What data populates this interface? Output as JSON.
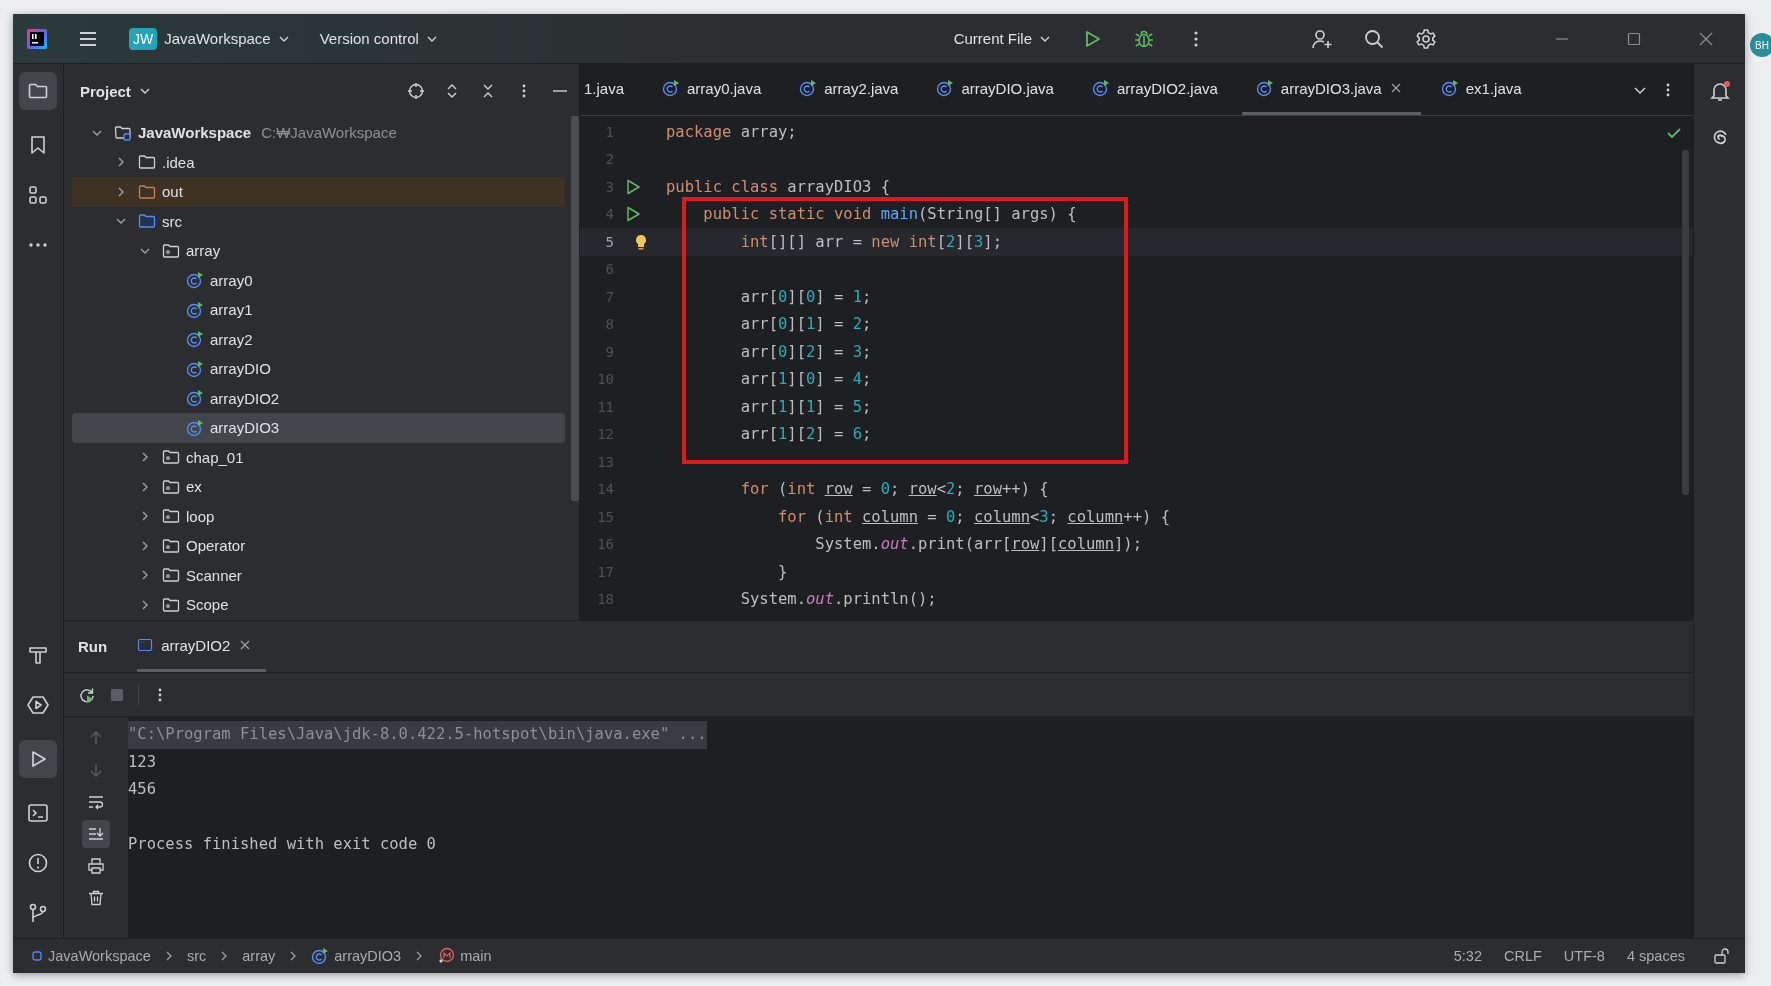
{
  "desktop": {
    "avatar": "BH"
  },
  "titlebar": {
    "project_badge": "JW",
    "project": "JavaWorkspace",
    "vcs": "Version control",
    "run_config": "Current File"
  },
  "project": {
    "title": "Project",
    "tree": [
      {
        "kind": "root",
        "label": "JavaWorkspace",
        "path": "C:₩JavaWorkspace",
        "expanded": true,
        "selected": false,
        "children": [
          {
            "kind": "folder",
            "label": ".idea",
            "expanded": false,
            "selected": false
          },
          {
            "kind": "excluded",
            "label": "out",
            "expanded": false,
            "selected": false
          },
          {
            "kind": "source",
            "label": "src",
            "expanded": true,
            "selected": false,
            "children": [
              {
                "kind": "package",
                "label": "array",
                "expanded": true,
                "selected": false,
                "children": [
                  {
                    "kind": "class",
                    "label": "array0",
                    "selected": false
                  },
                  {
                    "kind": "class",
                    "label": "array1",
                    "selected": false
                  },
                  {
                    "kind": "class",
                    "label": "array2",
                    "selected": false
                  },
                  {
                    "kind": "class",
                    "label": "arrayDIO",
                    "selected": false
                  },
                  {
                    "kind": "class",
                    "label": "arrayDIO2",
                    "selected": false
                  },
                  {
                    "kind": "class",
                    "label": "arrayDIO3",
                    "selected": true
                  }
                ]
              },
              {
                "kind": "package",
                "label": "chap_01",
                "expanded": false,
                "selected": false
              },
              {
                "kind": "package",
                "label": "ex",
                "expanded": false,
                "selected": false
              },
              {
                "kind": "package",
                "label": "loop",
                "expanded": false,
                "selected": false
              },
              {
                "kind": "package",
                "label": "Operator",
                "expanded": false,
                "selected": false
              },
              {
                "kind": "package",
                "label": "Scanner",
                "expanded": false,
                "selected": false
              },
              {
                "kind": "package",
                "label": "Scope",
                "expanded": false,
                "selected": false
              }
            ]
          }
        ]
      }
    ]
  },
  "editor": {
    "tabs": [
      {
        "label": "1.java",
        "icon": false,
        "selected": false
      },
      {
        "label": "array0.java",
        "icon": true,
        "selected": false
      },
      {
        "label": "array2.java",
        "icon": true,
        "selected": false
      },
      {
        "label": "arrayDIO.java",
        "icon": true,
        "selected": false
      },
      {
        "label": "arrayDIO2.java",
        "icon": true,
        "selected": false
      },
      {
        "label": "arrayDIO3.java",
        "icon": true,
        "selected": true
      },
      {
        "label": "ex1.java",
        "icon": true,
        "selected": false
      }
    ],
    "lines": [
      {
        "number": "1",
        "run_gutter": false,
        "bulb": false,
        "current": false,
        "boxed": false,
        "tokens": [
          {
            "kind": "kw",
            "text": "package"
          },
          {
            "kind": "plain",
            "text": " array;"
          }
        ]
      },
      {
        "number": "2",
        "run_gutter": false,
        "bulb": false,
        "current": false,
        "boxed": false
      },
      {
        "number": "3",
        "run_gutter": true,
        "bulb": false,
        "current": false,
        "boxed": false,
        "tokens": [
          {
            "kind": "kw",
            "text": "public class"
          },
          {
            "kind": "plain",
            "text": " arrayDIO3 {"
          }
        ]
      },
      {
        "number": "4",
        "run_gutter": true,
        "bulb": false,
        "current": false,
        "boxed": true,
        "tokens": [
          {
            "kind": "kw",
            "text": "    public static void "
          },
          {
            "kind": "fn",
            "text": "main"
          },
          {
            "kind": "plain",
            "text": "(String[] args) {"
          }
        ]
      },
      {
        "number": "5",
        "run_gutter": false,
        "bulb": true,
        "current": true,
        "boxed": true,
        "tokens": [
          {
            "kind": "kw",
            "text": "        int"
          },
          {
            "kind": "plain",
            "text": "[][] arr = "
          },
          {
            "kind": "kw",
            "text": "new int"
          },
          {
            "kind": "plain",
            "text": "["
          },
          {
            "kind": "num",
            "text": "2"
          },
          {
            "kind": "plain",
            "text": "]["
          },
          {
            "kind": "num",
            "text": "3"
          },
          {
            "kind": "plain",
            "text": "];"
          }
        ]
      },
      {
        "number": "6",
        "run_gutter": false,
        "bulb": false,
        "current": false,
        "boxed": true
      },
      {
        "number": "7",
        "run_gutter": false,
        "bulb": false,
        "current": false,
        "boxed": true,
        "tokens": [
          {
            "kind": "plain",
            "text": "        arr["
          },
          {
            "kind": "num",
            "text": "0"
          },
          {
            "kind": "plain",
            "text": "]["
          },
          {
            "kind": "num",
            "text": "0"
          },
          {
            "kind": "plain",
            "text": "] = "
          },
          {
            "kind": "num",
            "text": "1"
          },
          {
            "kind": "plain",
            "text": ";"
          }
        ]
      },
      {
        "number": "8",
        "run_gutter": false,
        "bulb": false,
        "current": false,
        "boxed": true,
        "tokens": [
          {
            "kind": "plain",
            "text": "        arr["
          },
          {
            "kind": "num",
            "text": "0"
          },
          {
            "kind": "plain",
            "text": "]["
          },
          {
            "kind": "num",
            "text": "1"
          },
          {
            "kind": "plain",
            "text": "] = "
          },
          {
            "kind": "num",
            "text": "2"
          },
          {
            "kind": "plain",
            "text": ";"
          }
        ]
      },
      {
        "number": "9",
        "run_gutter": false,
        "bulb": false,
        "current": false,
        "boxed": true,
        "tokens": [
          {
            "kind": "plain",
            "text": "        arr["
          },
          {
            "kind": "num",
            "text": "0"
          },
          {
            "kind": "plain",
            "text": "]["
          },
          {
            "kind": "num",
            "text": "2"
          },
          {
            "kind": "plain",
            "text": "] = "
          },
          {
            "kind": "num",
            "text": "3"
          },
          {
            "kind": "plain",
            "text": ";"
          }
        ]
      },
      {
        "number": "10",
        "run_gutter": false,
        "bulb": false,
        "current": false,
        "boxed": true,
        "tokens": [
          {
            "kind": "plain",
            "text": "        arr["
          },
          {
            "kind": "num",
            "text": "1"
          },
          {
            "kind": "plain",
            "text": "]["
          },
          {
            "kind": "num",
            "text": "0"
          },
          {
            "kind": "plain",
            "text": "] = "
          },
          {
            "kind": "num",
            "text": "4"
          },
          {
            "kind": "plain",
            "text": ";"
          }
        ]
      },
      {
        "number": "11",
        "run_gutter": false,
        "bulb": false,
        "current": false,
        "boxed": true,
        "tokens": [
          {
            "kind": "plain",
            "text": "        arr["
          },
          {
            "kind": "num",
            "text": "1"
          },
          {
            "kind": "plain",
            "text": "]["
          },
          {
            "kind": "num",
            "text": "1"
          },
          {
            "kind": "plain",
            "text": "] = "
          },
          {
            "kind": "num",
            "text": "5"
          },
          {
            "kind": "plain",
            "text": ";"
          }
        ]
      },
      {
        "number": "12",
        "run_gutter": false,
        "bulb": false,
        "current": false,
        "boxed": true,
        "tokens": [
          {
            "kind": "plain",
            "text": "        arr["
          },
          {
            "kind": "num",
            "text": "1"
          },
          {
            "kind": "plain",
            "text": "]["
          },
          {
            "kind": "num",
            "text": "2"
          },
          {
            "kind": "plain",
            "text": "] = "
          },
          {
            "kind": "num",
            "text": "6"
          },
          {
            "kind": "plain",
            "text": ";"
          }
        ]
      },
      {
        "number": "13",
        "run_gutter": false,
        "bulb": false,
        "current": false,
        "boxed": false
      },
      {
        "number": "14",
        "run_gutter": false,
        "bulb": false,
        "current": false,
        "boxed": false,
        "tokens": [
          {
            "kind": "kw",
            "text": "        for"
          },
          {
            "kind": "plain",
            "text": " ("
          },
          {
            "kind": "kw",
            "text": "int "
          },
          {
            "kind": "var",
            "text": "row"
          },
          {
            "kind": "plain",
            "text": " = "
          },
          {
            "kind": "num",
            "text": "0"
          },
          {
            "kind": "plain",
            "text": "; "
          },
          {
            "kind": "var",
            "text": "row"
          },
          {
            "kind": "plain",
            "text": "<"
          },
          {
            "kind": "num",
            "text": "2"
          },
          {
            "kind": "plain",
            "text": "; "
          },
          {
            "kind": "var",
            "text": "row"
          },
          {
            "kind": "plain",
            "text": "++) {"
          }
        ]
      },
      {
        "number": "15",
        "run_gutter": false,
        "bulb": false,
        "current": false,
        "boxed": false,
        "tokens": [
          {
            "kind": "kw",
            "text": "            for"
          },
          {
            "kind": "plain",
            "text": " ("
          },
          {
            "kind": "kw",
            "text": "int "
          },
          {
            "kind": "var",
            "text": "column"
          },
          {
            "kind": "plain",
            "text": " = "
          },
          {
            "kind": "num",
            "text": "0"
          },
          {
            "kind": "plain",
            "text": "; "
          },
          {
            "kind": "var",
            "text": "column"
          },
          {
            "kind": "plain",
            "text": "<"
          },
          {
            "kind": "num",
            "text": "3"
          },
          {
            "kind": "plain",
            "text": "; "
          },
          {
            "kind": "var",
            "text": "column"
          },
          {
            "kind": "plain",
            "text": "++) {"
          }
        ]
      },
      {
        "number": "16",
        "run_gutter": false,
        "bulb": false,
        "current": false,
        "boxed": false,
        "tokens": [
          {
            "kind": "plain",
            "text": "                System."
          },
          {
            "kind": "field",
            "text": "out"
          },
          {
            "kind": "plain",
            "text": ".print(arr["
          },
          {
            "kind": "var",
            "text": "row"
          },
          {
            "kind": "plain",
            "text": "]["
          },
          {
            "kind": "var",
            "text": "column"
          },
          {
            "kind": "plain",
            "text": "]);"
          }
        ]
      },
      {
        "number": "17",
        "run_gutter": false,
        "bulb": false,
        "current": false,
        "boxed": false,
        "tokens": [
          {
            "kind": "plain",
            "text": "            }"
          }
        ]
      },
      {
        "number": "18",
        "run_gutter": false,
        "bulb": false,
        "current": false,
        "boxed": false,
        "tokens": [
          {
            "kind": "plain",
            "text": "        System."
          },
          {
            "kind": "field",
            "text": "out"
          },
          {
            "kind": "plain",
            "text": ".println();"
          }
        ]
      }
    ]
  },
  "run": {
    "title": "Run",
    "tabs": [
      {
        "label": "arrayDIO2",
        "selected": true
      }
    ],
    "console": [
      {
        "kind": "command",
        "text": "\"C:\\Program Files\\Java\\jdk-8.0.422.5-hotspot\\bin\\java.exe\" ..."
      },
      {
        "kind": "output",
        "text": "123"
      },
      {
        "kind": "output",
        "text": "456"
      },
      {
        "kind": "status",
        "text": "Process finished with exit code 0"
      }
    ]
  },
  "status_bar": {
    "breadcrumbs": [
      {
        "kind": "project",
        "label": "JavaWorkspace"
      },
      {
        "kind": "folder",
        "label": "src"
      },
      {
        "kind": "folder",
        "label": "array"
      },
      {
        "kind": "class",
        "label": "arrayDIO3"
      },
      {
        "kind": "method",
        "label": "main"
      }
    ],
    "position": "5:32",
    "line_separator": "CRLF",
    "encoding": "UTF-8",
    "indent": "4 spaces"
  }
}
